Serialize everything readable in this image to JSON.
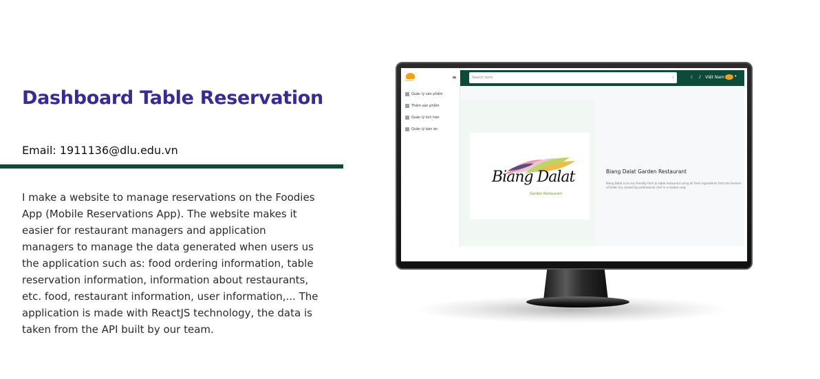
{
  "title": "Dashboard Table Reservation",
  "email": "Email: 1911136@dlu.edu.vn",
  "description_lines": [
    "I make a website to manage reservations on the Foodies",
    "App (Mobile Reservations App). The website makes it",
    "easier for restaurant managers and application",
    "managers to manage the data generated when users us",
    "the application such as: food ordering information, table",
    "reservation information, information about restaurants,",
    "etc. food, restaurant information, user information,... The",
    "application is made with ReactJS technology, the data is",
    "taken from the API built by our team."
  ],
  "colors": {
    "title": "#3b2a91",
    "divider": "#0e4a38",
    "topbar": "#0e4a38"
  },
  "screen": {
    "logo_text": "Foodies",
    "nav_items": [
      {
        "label": "Quản lý sản phẩm",
        "icon": "box-icon"
      },
      {
        "label": "Thêm sản phẩm",
        "icon": "cart-icon"
      },
      {
        "label": "Quản lý lịch hẹn",
        "icon": "truck-icon"
      },
      {
        "label": "Quản lý bàn ăn",
        "icon": "list-icon"
      }
    ],
    "search_placeholder": "Search term",
    "language": "Việt Nam",
    "logo_script": "Biang Dalat",
    "logo_sub": "Garden Restaurant",
    "restaurant_name": "Biang Dalat Garden Restaurant",
    "restaurant_desc": "Biang Dalat is an eco friendly farm to table restaurant using all fresh ingredients from the farmers of Dalat city cooked by professional chef in a modern way"
  }
}
